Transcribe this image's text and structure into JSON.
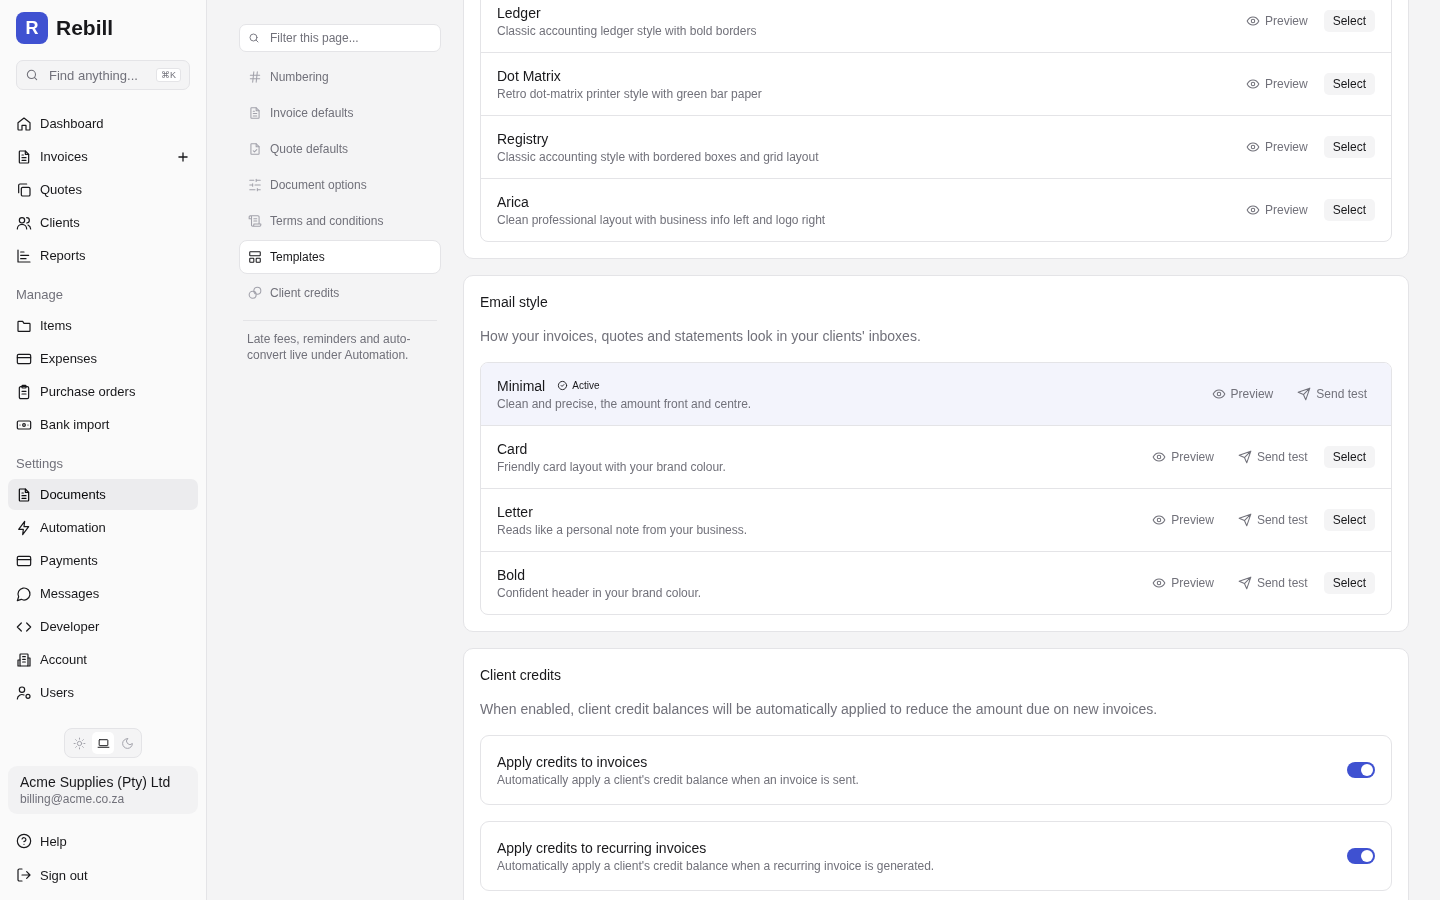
{
  "brand": {
    "logo_letter": "R",
    "name": "Rebill"
  },
  "sidebar": {
    "search": {
      "placeholder": "Find anything...",
      "shortcut": "⌘K"
    },
    "sections": [
      {
        "items": [
          {
            "label": "Dashboard",
            "selected": false
          },
          {
            "label": "Invoices",
            "selected": false,
            "add_button": true
          },
          {
            "label": "Quotes",
            "selected": false
          },
          {
            "label": "Clients",
            "selected": false
          },
          {
            "label": "Reports",
            "selected": false
          }
        ]
      },
      {
        "title": "Manage",
        "items": [
          {
            "label": "Items",
            "selected": false
          },
          {
            "label": "Expenses",
            "selected": false
          },
          {
            "label": "Purchase orders",
            "selected": false
          },
          {
            "label": "Bank import",
            "selected": false
          }
        ]
      },
      {
        "title": "Settings",
        "items": [
          {
            "label": "Documents",
            "selected": true
          },
          {
            "label": "Automation",
            "selected": false
          },
          {
            "label": "Payments",
            "selected": false
          },
          {
            "label": "Messages",
            "selected": false
          },
          {
            "label": "Developer",
            "selected": false
          },
          {
            "label": "Account",
            "selected": false
          },
          {
            "label": "Users",
            "selected": false
          }
        ]
      }
    ],
    "theme_modes": [
      {
        "selected": false
      },
      {
        "selected": true
      },
      {
        "selected": false
      }
    ],
    "account": {
      "name": "Acme Supplies (Pty) Ltd",
      "email": "billing@acme.co.za"
    },
    "footer_links": [
      "Help",
      "Sign out"
    ]
  },
  "subnav": {
    "filter": {
      "placeholder": "Filter this page..."
    },
    "items": [
      {
        "label": "Numbering",
        "selected": false
      },
      {
        "label": "Invoice defaults",
        "selected": false
      },
      {
        "label": "Quote defaults",
        "selected": false
      },
      {
        "label": "Document options",
        "selected": false
      },
      {
        "label": "Terms and conditions",
        "selected": false
      },
      {
        "label": "Templates",
        "selected": true
      },
      {
        "label": "Client credits",
        "selected": false
      }
    ],
    "note": "Late fees, reminders and auto-convert live under Automation."
  },
  "document_templates": [
    {
      "name": "Ledger",
      "description": "Classic accounting ledger style with bold borders",
      "preview": "Preview",
      "select": "Select"
    },
    {
      "name": "Dot Matrix",
      "description": "Retro dot-matrix printer style with green bar paper",
      "preview": "Preview",
      "select": "Select"
    },
    {
      "name": "Registry",
      "description": "Classic accounting style with bordered boxes and grid layout",
      "preview": "Preview",
      "select": "Select"
    },
    {
      "name": "Arica",
      "description": "Clean professional layout with business info left and logo right",
      "preview": "Preview",
      "select": "Select"
    }
  ],
  "email_style": {
    "title": "Email style",
    "description": "How your invoices, quotes and statements look in your clients' inboxes.",
    "styles": [
      {
        "name": "Minimal",
        "active": true,
        "badge": "Active",
        "description": "Clean and precise, the amount front and centre.",
        "preview": "Preview",
        "send_test": "Send test"
      },
      {
        "name": "Card",
        "active": false,
        "description": "Friendly card layout with your brand colour.",
        "preview": "Preview",
        "send_test": "Send test",
        "select": "Select"
      },
      {
        "name": "Letter",
        "active": false,
        "description": "Reads like a personal note from your business.",
        "preview": "Preview",
        "send_test": "Send test",
        "select": "Select"
      },
      {
        "name": "Bold",
        "active": false,
        "description": "Confident header in your brand colour.",
        "preview": "Preview",
        "send_test": "Send test",
        "select": "Select"
      }
    ]
  },
  "client_credits": {
    "title": "Client credits",
    "description": "When enabled, client credit balances will be automatically applied to reduce the amount due on new invoices.",
    "settings": [
      {
        "title": "Apply credits to invoices",
        "description": "Automatically apply a client's credit balance when an invoice is sent.",
        "on": true
      },
      {
        "title": "Apply credits to recurring invoices",
        "description": "Automatically apply a client's credit balance when a recurring invoice is generated.",
        "on": true
      }
    ]
  }
}
